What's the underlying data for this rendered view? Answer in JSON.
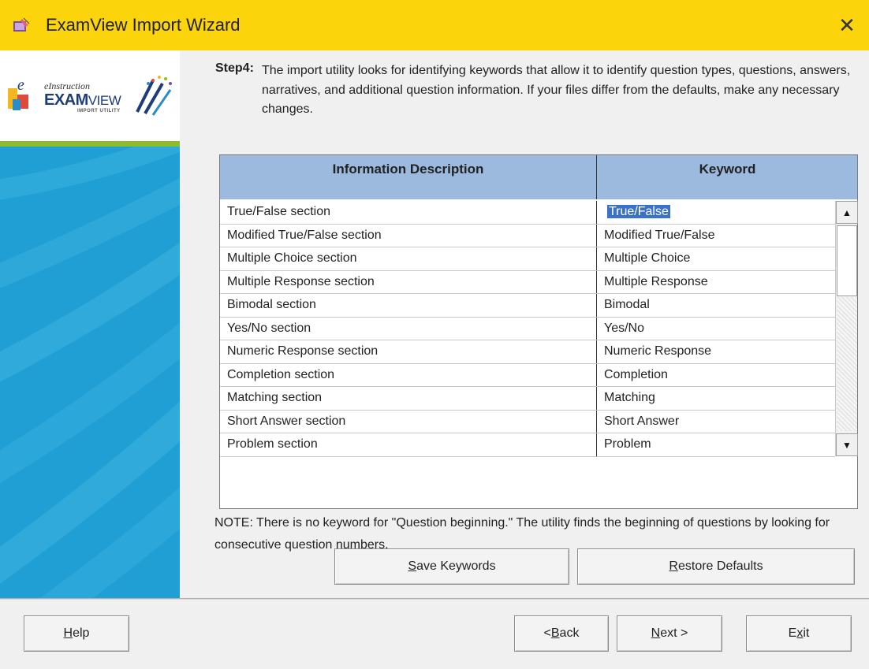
{
  "window": {
    "title": "ExamView Import Wizard",
    "close_glyph": "✕"
  },
  "logo": {
    "brand_small": "eInstruction",
    "brand_main_bold": "EXAM",
    "brand_main_light": "VIEW",
    "brand_sub": "IMPORT UTILITY"
  },
  "step": {
    "label": "Step4:",
    "text": "The import utility looks for identifying keywords that allow it to identify question types, questions, answers, narratives, and additional question information.  If your files differ from the defaults, make any necessary changes."
  },
  "grid": {
    "headers": [
      "Information Description",
      "Keyword"
    ],
    "rows": [
      {
        "description": "True/False section",
        "keyword": "True/False",
        "selected": true
      },
      {
        "description": "Modified True/False section",
        "keyword": "Modified True/False"
      },
      {
        "description": "Multiple Choice section",
        "keyword": "Multiple Choice"
      },
      {
        "description": "Multiple Response section",
        "keyword": "Multiple Response"
      },
      {
        "description": "Bimodal section",
        "keyword": "Bimodal"
      },
      {
        "description": "Yes/No section",
        "keyword": "Yes/No"
      },
      {
        "description": "Numeric Response section",
        "keyword": "Numeric Response"
      },
      {
        "description": "Completion section",
        "keyword": "Completion"
      },
      {
        "description": "Matching section",
        "keyword": "Matching"
      },
      {
        "description": "Short Answer section",
        "keyword": "Short Answer"
      },
      {
        "description": "Problem section",
        "keyword": "Problem"
      }
    ]
  },
  "note": "NOTE: There is no keyword for \"Question beginning.\"  The utility finds the beginning of questions by looking for consecutive question numbers.",
  "buttons": {
    "save_keywords_pre": "",
    "save_keywords_u": "S",
    "save_keywords_post": "ave Keywords",
    "restore_defaults_pre": "",
    "restore_defaults_u": "R",
    "restore_defaults_post": "estore Defaults",
    "help_pre": "",
    "help_u": "H",
    "help_post": "elp",
    "back_pre": "< ",
    "back_u": "B",
    "back_post": "ack",
    "next_pre": "",
    "next_u": "N",
    "next_post": "ext >",
    "exit_pre": "E",
    "exit_u": "x",
    "exit_post": "it"
  },
  "colors": {
    "titlebar": "#fbd40c",
    "sidebar_blue": "#1f9fd3",
    "sidebar_green": "#8dbd2c",
    "grid_header": "#9cb9de",
    "selection": "#3a72c8"
  }
}
